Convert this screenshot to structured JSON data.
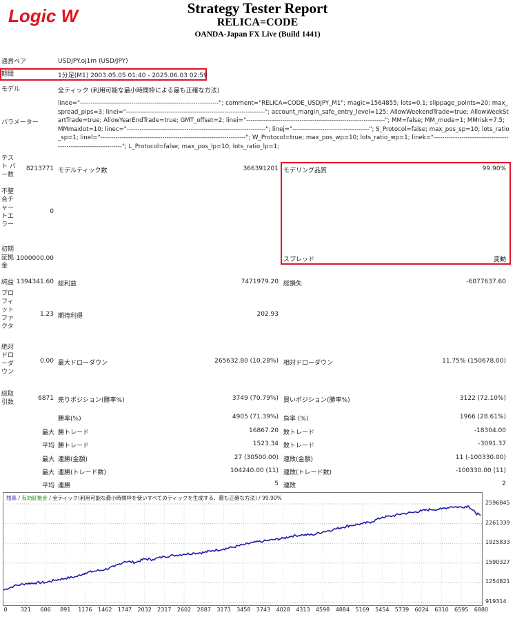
{
  "header": {
    "logo_text": "Logic W",
    "title": "Strategy Tester Report",
    "ea_name": "RELICA=CODE",
    "server": "OANDA-Japan FX Live (Build 1441)"
  },
  "info": {
    "symbol_label": "通貨ペア",
    "symbol_value": "USDJPY.oj1m (USD/JPY)",
    "period_label": "期間",
    "period_value": "1分足(M1) 2003.05.05 01:40 - 2025.06.03 02:59",
    "model_label": "モデル",
    "model_value": "全ティック (利用可能な最小時間枠による最も正確な方法)",
    "params_label": "パラメーター",
    "params_value": "linee=\"-----------------------------------------------------------------\"; comment=\"RELICA=CODE_USDJPY_M1\"; magic=1564855; lots=0.1; slippage_points=20; max_spread_pips=3; linei=\"-----------------------------------------------------------------\"; account_margin_safe_entry_level=125; AllowWeekendTrade=true; AllowWeekStartTrade=true; AllowYearEndTrade=true; GMT_offset=2; linei=\"-----------------------------------------------------------------\"; MM=false; MM_mode=1; MMrisk=7.5; MMmaxlot=10; linec=\"-----------------------------------------------------------------\"; linej=\"------------------------------------\"; S_Protocol=false; max_pos_sp=10; lots_ratio_sp=1; linel=\"--------------------------------------------------------------------\"; W_Protocol=true; max_pos_wp=10; lots_ratio_wp=1; linek=\"-----------------------------------------------------------------\"; L_Protocol=false; max_pos_lp=10; lots_ratio_lp=1;"
  },
  "stats": {
    "test_bars_label": "テスト\nバー数",
    "test_bars_value": "8213771",
    "model_ticks_label": "モデルティック数",
    "model_ticks_value": "366391201",
    "model_quality_label": "モデリング品質",
    "model_quality_value": "99.90%",
    "mismatch_label": "不整合チャートエラー",
    "mismatch_value": "0",
    "deposit_label": "初期証拠金",
    "deposit_value": "1000000.00",
    "spread_label": "スプレッド",
    "spread_value": "変動",
    "net_profit_label": "純益",
    "net_profit_value": "1394341.60",
    "gross_profit_label": "総利益",
    "gross_profit_value": "7471979.20",
    "gross_loss_label": "総損失",
    "gross_loss_value": "-6077637.60",
    "pf_label": "プロフィットファクタ",
    "pf_value": "1.23",
    "expected_label": "期待利得",
    "expected_value": "202.93",
    "abs_dd_label": "絶対ドローダウン",
    "abs_dd_value": "0.00",
    "max_dd_label": "最大ドローダウン",
    "max_dd_value": "265632.80 (10.28%)",
    "rel_dd_label": "相対ドローダウン",
    "rel_dd_value": "11.75% (150678.00)",
    "total_trades_label": "総取引数",
    "total_trades_value": "6871",
    "short_label": "売りポジション(勝率%)",
    "short_value": "3749 (70.79%)",
    "long_label": "買いポジション(勝率%)",
    "long_value": "3122 (72.10%)",
    "win_rate_label": "勝率(%)",
    "win_rate_value": "4905 (71.39%)",
    "loss_rate_label": "負率 (%)",
    "loss_rate_value": "1966 (28.61%)",
    "max_prefix": "最大",
    "avg_prefix": "平均",
    "largest_win_label": "勝トレード",
    "largest_win_value": "16867.20",
    "largest_loss_label": "敗トレード",
    "largest_loss_value": "-18304.00",
    "avg_win_label": "勝トレード",
    "avg_win_value": "1523.34",
    "avg_loss_label": "敗トレード",
    "avg_loss_value": "-3091.37",
    "max_cons_wins_label": "連勝(金額)",
    "max_cons_wins_value": "27 (30500.00)",
    "max_cons_losses_label": "連敗(金額)",
    "max_cons_losses_value": "11 (-100330.00)",
    "max_cons_profit_label": "連勝(トレード数)",
    "max_cons_profit_value": "104240.00 (11)",
    "max_cons_loss_label": "連敗(トレード数)",
    "max_cons_loss_value": "-100330.00 (11)",
    "avg_cons_wins_label": "連勝",
    "avg_cons_wins_value": "5",
    "avg_cons_losses_label": "連敗",
    "avg_cons_losses_value": "2"
  },
  "chart": {
    "legend_balance": "残高",
    "legend_equity": "有効証拠金",
    "legend_model": "全ティック(利用可能な最小時間枠を使いすべてのティックを生成する、最も正確な方法)",
    "legend_quality": "99.90%",
    "colors": {
      "line": "#1c1ca8",
      "frame": "#777777",
      "red_box": "#e0142a"
    }
  },
  "chart_data": {
    "type": "line",
    "title": "",
    "xlabel": "",
    "ylabel": "",
    "x_ticks": [
      "0",
      "321",
      "606",
      "891",
      "1176",
      "1462",
      "1747",
      "2032",
      "2317",
      "2602",
      "2887",
      "3173",
      "3458",
      "3743",
      "4028",
      "4313",
      "4598",
      "4884",
      "5169",
      "5454",
      "5739",
      "6024",
      "6310",
      "6595",
      "6880"
    ],
    "y_ticks": [
      "2596845",
      "2261339",
      "1925833",
      "1590327",
      "1254821",
      "919314"
    ],
    "ylim": [
      919314,
      2596845
    ],
    "xlim": [
      0,
      6871
    ],
    "series": [
      {
        "x": [
          0,
          150,
          321,
          450,
          606,
          750,
          891,
          1050,
          1176,
          1300,
          1462,
          1600,
          1747,
          1900,
          2032,
          2150,
          2317,
          2450,
          2602,
          2750,
          2887,
          3000,
          3173,
          3300,
          3458,
          3600,
          3743,
          3900,
          4028,
          4150,
          4313,
          4450,
          4598,
          4750,
          4884,
          5000,
          5169,
          5300,
          5454,
          5600,
          5739,
          5900,
          6024,
          6150,
          6310,
          6450,
          6595,
          6700,
          6800,
          6871
        ],
        "values": [
          1130000,
          1200000,
          1240000,
          1250000,
          1260000,
          1300000,
          1330000,
          1360000,
          1420000,
          1450000,
          1480000,
          1530000,
          1620000,
          1600000,
          1660000,
          1650000,
          1700000,
          1720000,
          1740000,
          1760000,
          1770000,
          1800000,
          1830000,
          1860000,
          1900000,
          1940000,
          1960000,
          1990000,
          2010000,
          2050000,
          2070000,
          2070000,
          2120000,
          2160000,
          2200000,
          2230000,
          2260000,
          2290000,
          2370000,
          2390000,
          2430000,
          2450000,
          2480000,
          2500000,
          2510000,
          2550000,
          2540000,
          2560000,
          2440000,
          2400000
        ]
      }
    ]
  }
}
